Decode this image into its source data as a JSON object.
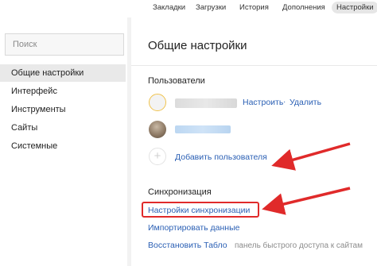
{
  "tabs": [
    {
      "label": "Закладки"
    },
    {
      "label": "Загрузки"
    },
    {
      "label": "История"
    },
    {
      "label": "Дополнения"
    },
    {
      "label": "Настройки",
      "active": true
    }
  ],
  "sidebar": {
    "search_placeholder": "Поиск",
    "items": [
      {
        "label": "Общие настройки",
        "active": true
      },
      {
        "label": "Интерфейс"
      },
      {
        "label": "Инструменты"
      },
      {
        "label": "Сайты"
      },
      {
        "label": "Системные"
      }
    ]
  },
  "main": {
    "title": "Общие настройки",
    "users": {
      "heading": "Пользователи",
      "configure_label": "Настроить",
      "separator": "·",
      "delete_label": "Удалить",
      "add_user_label": "Добавить пользователя"
    },
    "sync": {
      "heading": "Синхронизация",
      "settings_label": "Настройки синхронизации",
      "import_label": "Импортировать данные",
      "restore_label": "Восстановить Табло",
      "restore_hint": "панель быстрого доступа к сайтам"
    }
  },
  "colors": {
    "accent_link": "#2a5fb4",
    "highlight": "#e02a2a",
    "active_bg": "#e9e9e9"
  },
  "icons": [
    "avatar-placeholder-icon",
    "user-photo-avatar",
    "plus-icon",
    "arrow-annotation"
  ]
}
